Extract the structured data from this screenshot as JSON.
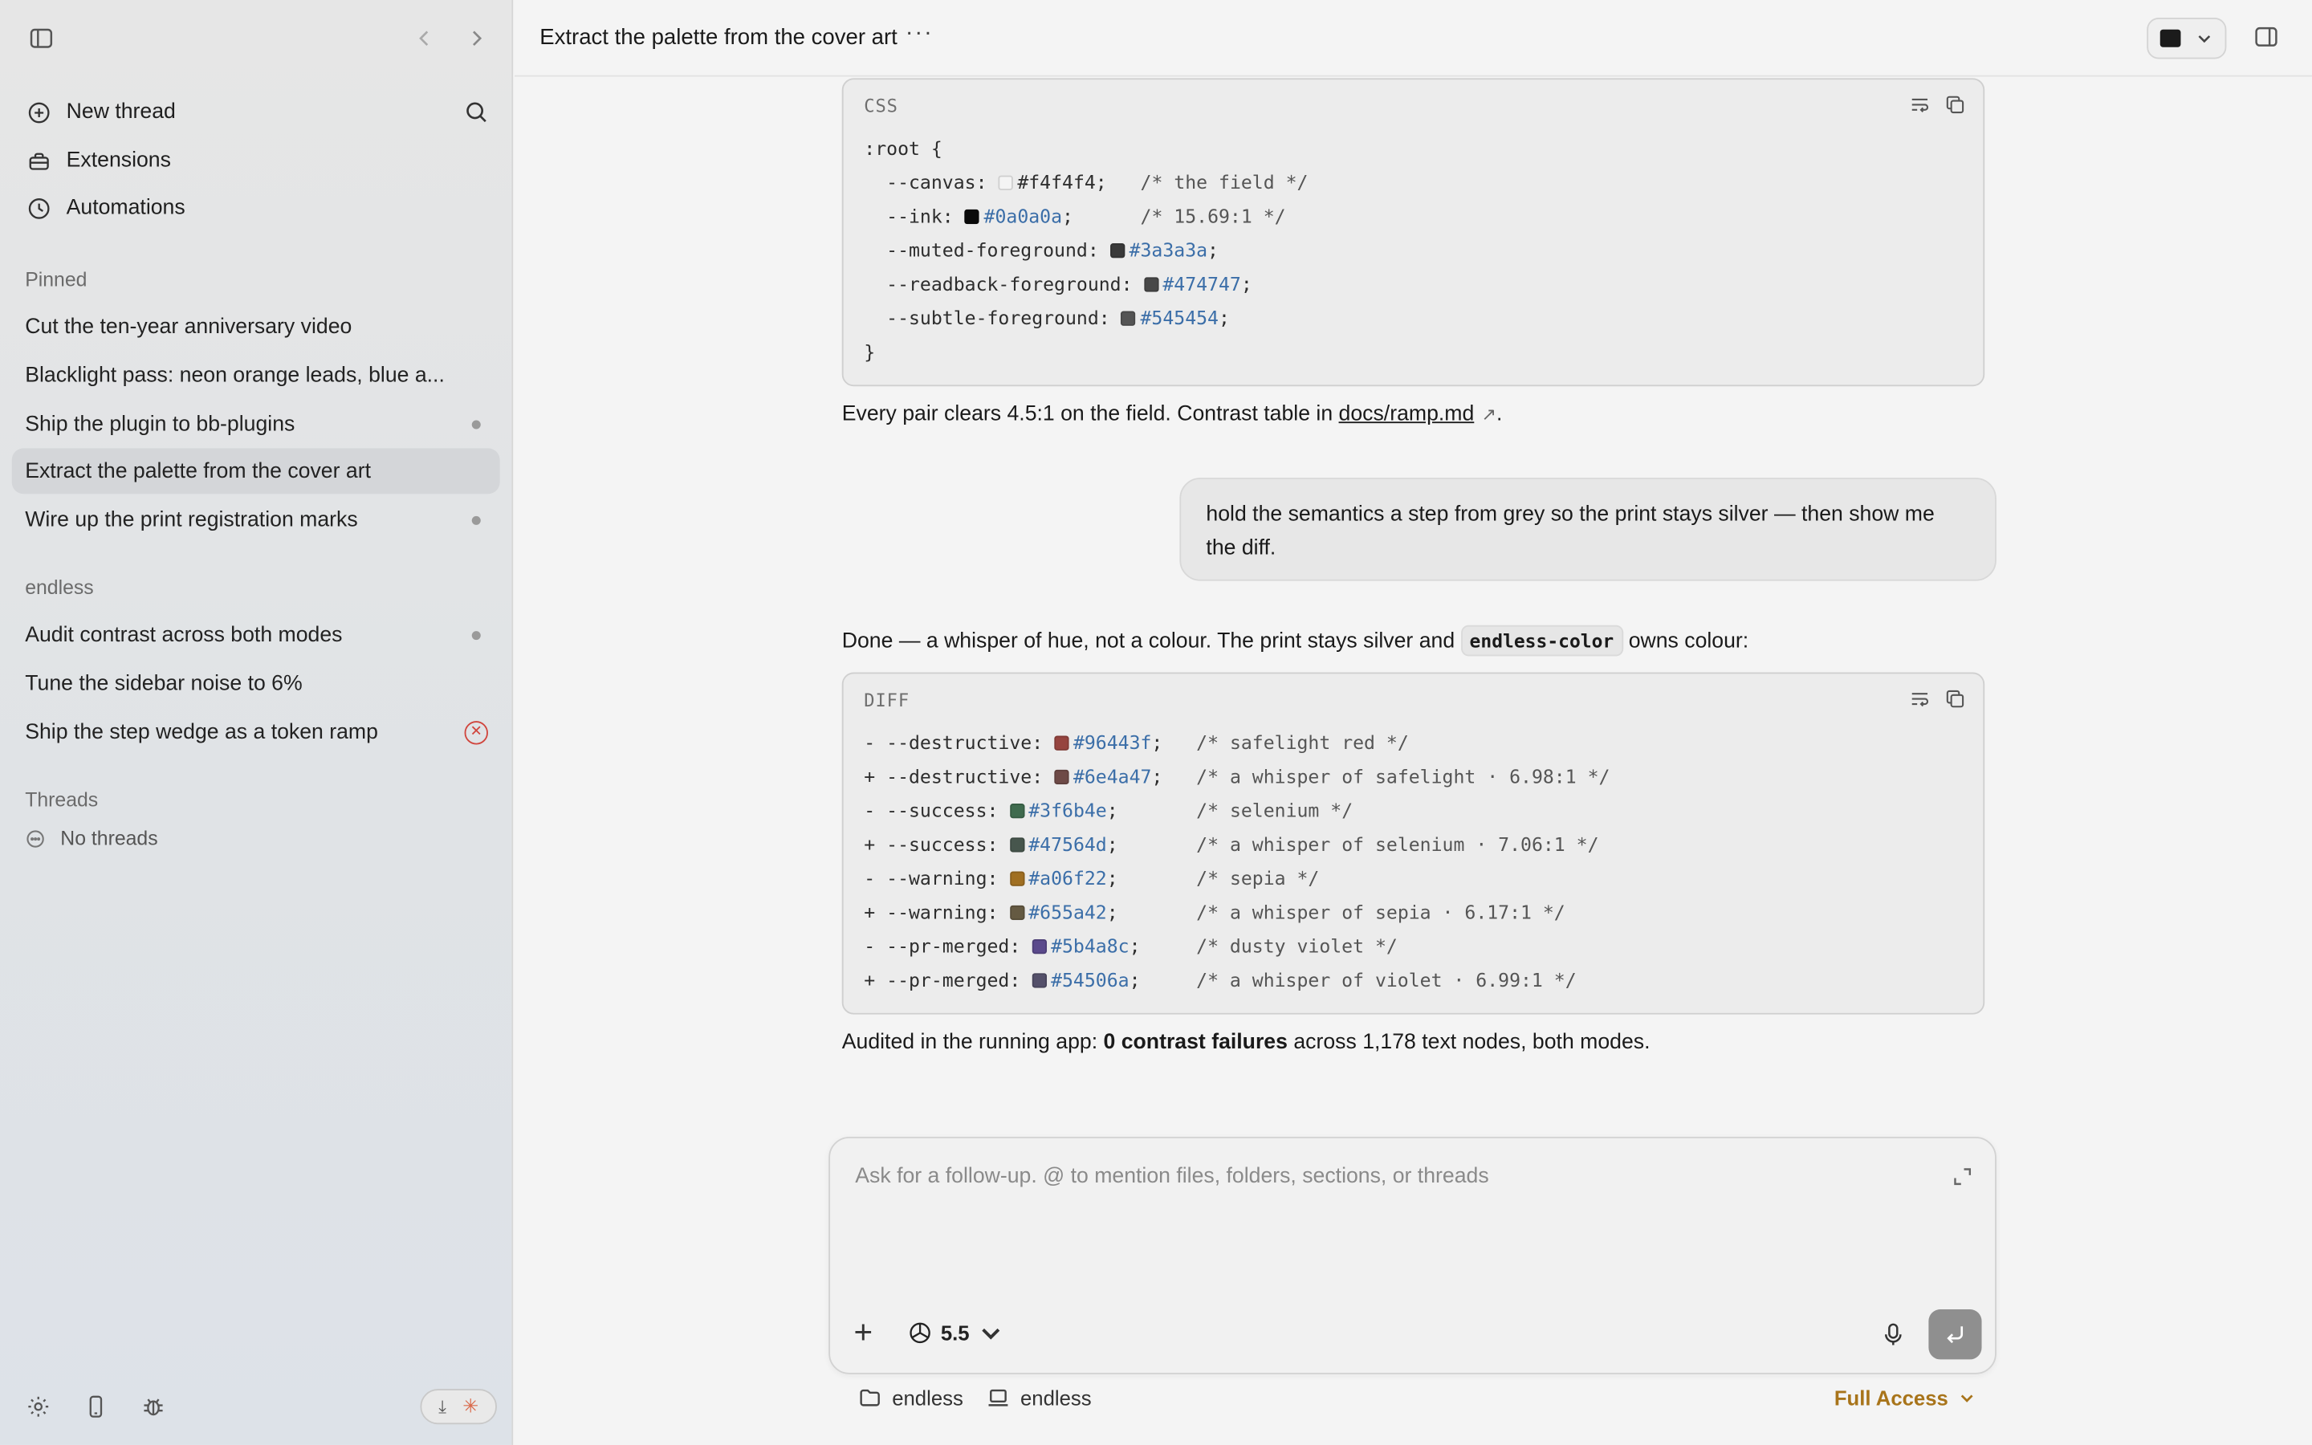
{
  "sidebar": {
    "nav": [
      {
        "label": "New thread",
        "icon": "plus-circle-icon"
      },
      {
        "label": "Extensions",
        "icon": "toolbox-icon"
      },
      {
        "label": "Automations",
        "icon": "clock-icon"
      }
    ],
    "pinned_label": "Pinned",
    "pinned": [
      {
        "label": "Cut the ten-year anniversary video"
      },
      {
        "label": "Blacklight pass: neon orange leads, blue a..."
      },
      {
        "label": "Ship the plugin to bb-plugins"
      },
      {
        "label": "Extract the palette from the cover art"
      },
      {
        "label": "Wire up the print registration marks"
      }
    ],
    "project_label": "endless",
    "project_threads": [
      {
        "label": "Audit contrast across both modes"
      },
      {
        "label": "Tune the sidebar noise to 6%"
      },
      {
        "label": "Ship the step wedge as a token ramp"
      }
    ],
    "threads_label": "Threads",
    "no_threads": "No threads"
  },
  "header": {
    "title": "Extract the palette from the cover art",
    "more": "···"
  },
  "css_block": {
    "lang": "CSS",
    "open": ":root {",
    "close": "}",
    "lines": [
      {
        "prop": "  --canvas: ",
        "color": "#f4f4f4",
        "hex": "#f4f4f4",
        "after": ";   ",
        "comment": "/* the field */",
        "hex_plain": true
      },
      {
        "prop": "  --ink: ",
        "color": "#0a0a0a",
        "hex": "#0a0a0a",
        "after": ";      ",
        "comment": "/* 15.69:1 */",
        "hex_plain": false
      },
      {
        "prop": "  --muted-foreground: ",
        "color": "#3a3a3a",
        "hex": "#3a3a3a",
        "after": ";",
        "comment": "",
        "hex_plain": false
      },
      {
        "prop": "  --readback-foreground: ",
        "color": "#474747",
        "hex": "#474747",
        "after": ";",
        "comment": "",
        "hex_plain": false
      },
      {
        "prop": "  --subtle-foreground: ",
        "color": "#545454",
        "hex": "#545454",
        "after": ";",
        "comment": "",
        "hex_plain": false
      }
    ]
  },
  "para1": {
    "text": "Every pair clears 4.5:1 on the field. Contrast table in ",
    "link": "docs/ramp.md",
    "end": "."
  },
  "user_message": "hold the semantics a step from grey so the print stays silver — then show me the diff.",
  "para2": {
    "before": "Done — a whisper of hue, not a colour. The print stays silver and ",
    "code": "endless-color",
    "after": " owns colour:"
  },
  "diff_block": {
    "lang": "DIFF",
    "lines": [
      {
        "prop": "- --destructive: ",
        "color": "#96443f",
        "hex": "#96443f",
        "pad": ";   ",
        "comment": "/* safelight red */"
      },
      {
        "prop": "+ --destructive: ",
        "color": "#6e4a47",
        "hex": "#6e4a47",
        "pad": ";   ",
        "comment": "/* a whisper of safelight · 6.98:1 */"
      },
      {
        "prop": "- --success: ",
        "color": "#3f6b4e",
        "hex": "#3f6b4e",
        "pad": ";       ",
        "comment": "/* selenium */"
      },
      {
        "prop": "+ --success: ",
        "color": "#47564d",
        "hex": "#47564d",
        "pad": ";       ",
        "comment": "/* a whisper of selenium · 7.06:1 */"
      },
      {
        "prop": "- --warning: ",
        "color": "#a06f22",
        "hex": "#a06f22",
        "pad": ";       ",
        "comment": "/* sepia */"
      },
      {
        "prop": "+ --warning: ",
        "color": "#655a42",
        "hex": "#655a42",
        "pad": ";       ",
        "comment": "/* a whisper of sepia · 6.17:1 */"
      },
      {
        "prop": "- --pr-merged: ",
        "color": "#5b4a8c",
        "hex": "#5b4a8c",
        "pad": ";     ",
        "comment": "/* dusty violet */"
      },
      {
        "prop": "+ --pr-merged: ",
        "color": "#54506a",
        "hex": "#54506a",
        "pad": ";     ",
        "comment": "/* a whisper of violet · 6.99:1 */"
      }
    ]
  },
  "para3": {
    "before": "Audited in the running app: ",
    "bold": "0 contrast failures",
    "after": " across 1,178 text nodes, both modes."
  },
  "composer": {
    "placeholder": "Ask for a follow-up. @ to mention files, folders, sections, or threads",
    "model": "5.5"
  },
  "footer": {
    "folder": "endless",
    "env": "endless",
    "access": "Full Access"
  },
  "colors": {
    "accent_access": "#a8741a",
    "error": "#d0453d",
    "hex_text": "#3b6ea8"
  }
}
